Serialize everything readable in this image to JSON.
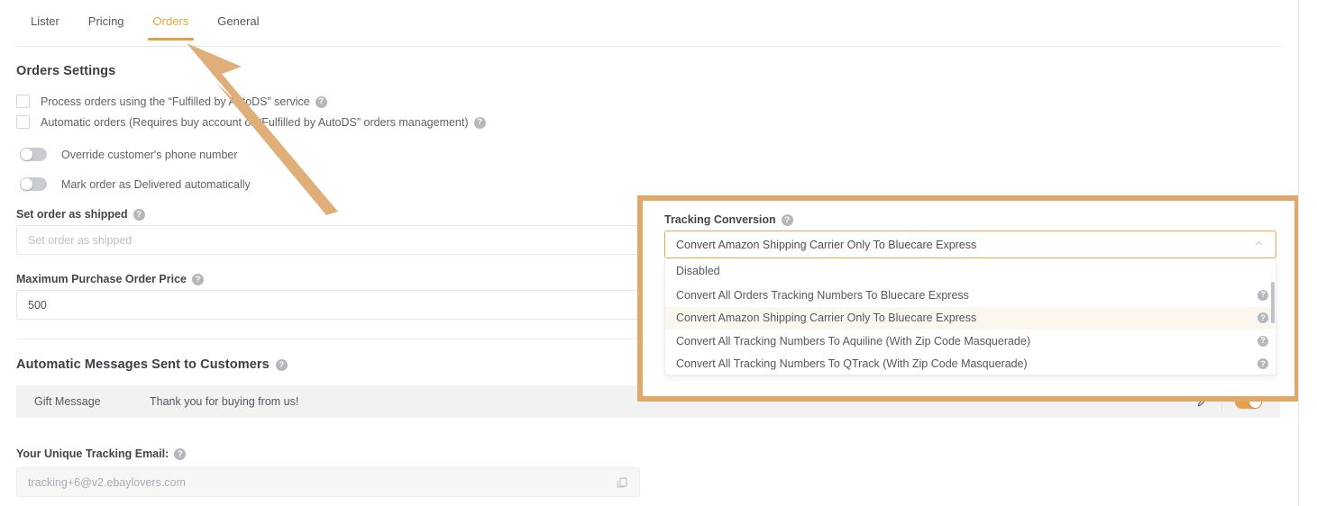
{
  "tabs": [
    {
      "label": "Lister",
      "active": false
    },
    {
      "label": "Pricing",
      "active": false
    },
    {
      "label": "Orders",
      "active": true
    },
    {
      "label": "General",
      "active": false
    }
  ],
  "orders_settings": {
    "heading": "Orders Settings",
    "checkboxes": [
      {
        "label": "Process orders using the “Fulfilled by AutoDS” service",
        "checked": false,
        "help": "?"
      },
      {
        "label": "Automatic orders (Requires buy account or “Fulfilled by AutoDS” orders management)",
        "checked": false,
        "help": "?"
      }
    ],
    "toggles": [
      {
        "label": "Override customer's phone number",
        "on": false
      },
      {
        "label": "Mark order as Delivered automatically",
        "on": false
      }
    ],
    "set_order_as_shipped": {
      "label": "Set order as shipped",
      "help": "?",
      "value": "",
      "placeholder": "Set order as shipped",
      "chevron": "chevron-down-icon"
    },
    "maximum_purchase_order_price": {
      "label": "Maximum Purchase Order Price",
      "help": "?",
      "value": "500"
    }
  },
  "tracking_conversion": {
    "label": "Tracking Conversion",
    "help": "?",
    "selected": "Convert Amazon Shipping Carrier Only To Bluecare Express",
    "chevron": "chevron-up-icon",
    "expanded": true,
    "options": [
      {
        "label": "Disabled",
        "help": null,
        "highlighted": false
      },
      {
        "label": "Convert All Orders Tracking Numbers To Bluecare Express",
        "help": "?",
        "highlighted": false
      },
      {
        "label": "Convert Amazon Shipping Carrier Only To Bluecare Express",
        "help": "?",
        "highlighted": true
      },
      {
        "label": "Convert All Tracking Numbers To Aquiline (With Zip Code Masquerade)",
        "help": "?",
        "highlighted": false
      },
      {
        "label": "Convert All Tracking Numbers To QTrack (With Zip Code Masquerade)",
        "help": "?",
        "highlighted": false
      }
    ]
  },
  "automatic_messages": {
    "heading": "Automatic Messages Sent to Customers",
    "help": "?",
    "rows": [
      {
        "name": "Gift Message",
        "text": "Thank you for buying from us!",
        "edit_icon": "pencil-icon",
        "toggle_on": true
      }
    ]
  },
  "tracking_email": {
    "label": "Your Unique Tracking Email:",
    "help": "?",
    "value": "",
    "placeholder": "tracking+6@v2.ebaylovers.com",
    "copy_icon": "copy-icon"
  },
  "annotation": {
    "arrow": "pointer-arrow",
    "color": "#dfae79",
    "points_to": "Orders"
  },
  "colors": {
    "accent": "#e0a14c",
    "highlight_border": "#e0a869",
    "option_highlight_bg": "#fdf8ef",
    "toggle_on": "#e5a24a",
    "row_bg": "#f2f2f3"
  }
}
